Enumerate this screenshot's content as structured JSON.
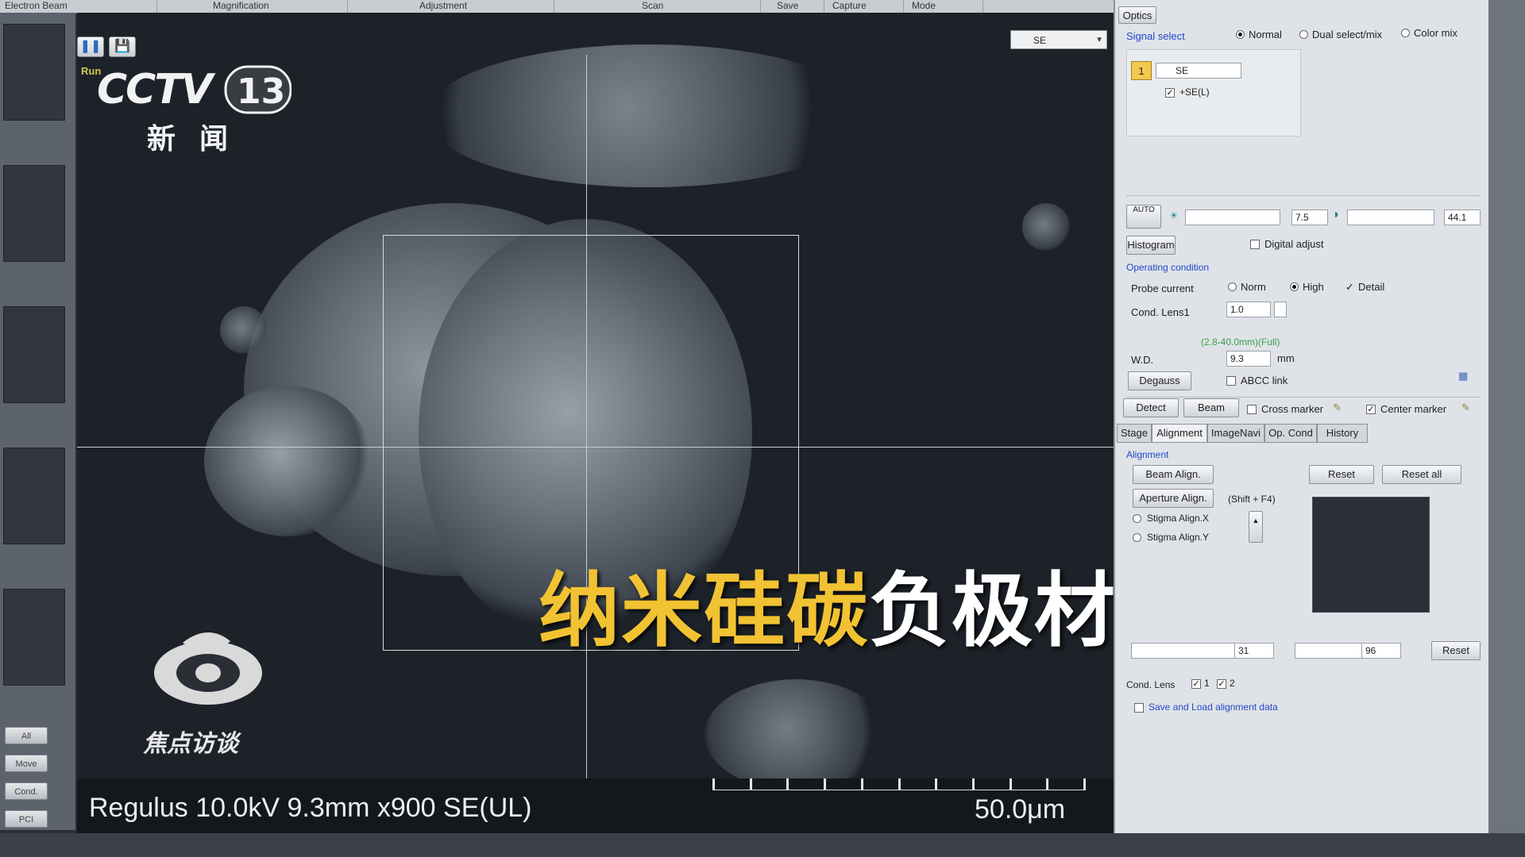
{
  "menu": {
    "items": [
      "Electron Beam",
      "Magnification",
      "Adjustment",
      "Scan",
      "Save",
      "Capture",
      "Mode"
    ]
  },
  "left_panel": {
    "buttons": [
      "All",
      "Move",
      "Cond.",
      "PCI"
    ]
  },
  "viewer": {
    "run_label": "Run",
    "detector_select": "SE",
    "info_text": "Regulus 10.0kV 9.3mm x900 SE(UL)",
    "scale_text": "50.0μm",
    "scale_ticks": 11
  },
  "overlay": {
    "channel_logo": "CCTV",
    "channel_number": "13",
    "channel_sub": "新闻",
    "program_name": "焦点访谈",
    "caption_yellow": "纳米硅碳",
    "caption_white": "负极材料"
  },
  "optics": {
    "tab_label": "Optics",
    "signal_select_label": "Signal select",
    "signal_modes": [
      "Normal",
      "Dual select/mix",
      "Color mix"
    ],
    "signal_mode_selected": "Normal",
    "channel_number": "1",
    "channel_detector": "SE",
    "se_l_checkbox": "+SE(L)",
    "auto_button": "AUTO",
    "contrast_value": "7.5",
    "brightness_value": "44.1",
    "histogram_button": "Histogram",
    "digital_adjust_label": "Digital adjust",
    "operating_condition_label": "Operating condition",
    "probe_current_label": "Probe current",
    "probe_options": [
      "Norm",
      "High"
    ],
    "probe_selected": "High",
    "detail_label": "Detail",
    "cond_lens1_label": "Cond. Lens1",
    "cond_lens1_value": "1.0",
    "wd_range": "(2.8-40.0mm)(Full)",
    "wd_label": "W.D.",
    "wd_value": "9.3",
    "wd_unit": "mm",
    "degauss_button": "Degauss",
    "abcc_label": "ABCC link",
    "detect_button": "Detect",
    "beam_button": "Beam",
    "cross_marker_label": "Cross marker",
    "center_marker_label": "Center marker"
  },
  "tabs": [
    "Stage",
    "Alignment",
    "ImageNavi",
    "Op. Cond",
    "History"
  ],
  "alignment": {
    "section_label": "Alignment",
    "beam_align_button": "Beam Align.",
    "aperture_align_button": "Aperture Align.",
    "shortcut_hint": "(Shift + F4)",
    "reset_button": "Reset",
    "reset_all_button": "Reset all",
    "stigma_x_label": "Stigma Align.X",
    "stigma_y_label": "Stigma Align.Y",
    "x_value": "31",
    "y_value": "96",
    "reset2_button": "Reset",
    "cond_lens_label": "Cond. Lens",
    "cond_lens_checks": [
      "1",
      "2"
    ],
    "save_load_label": "Save and Load alignment data"
  }
}
